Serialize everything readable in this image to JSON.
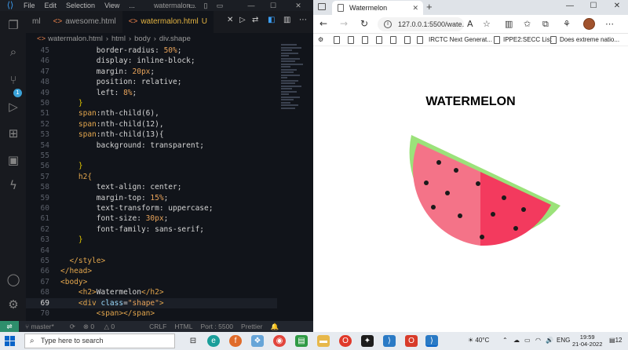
{
  "vscode": {
    "menu": [
      "File",
      "Edit",
      "Selection",
      "View",
      "..."
    ],
    "window_title": "watermalon...",
    "tabs": [
      {
        "label": "ml"
      },
      {
        "label": "awesome.html"
      },
      {
        "label": "watermalon.html",
        "modified": "U"
      }
    ],
    "breadcrumb": [
      "watermalon.html",
      "html",
      "body",
      "div.shape"
    ],
    "code_lines": [
      {
        "n": "45",
        "segs": [
          [
            "        border-radius: ",
            "#d4d4d4"
          ],
          [
            "50%",
            "#e8a35a"
          ],
          [
            ";",
            "#d4d4d4"
          ]
        ]
      },
      {
        "n": "46",
        "segs": [
          [
            "        display: inline-block;",
            "#d4d4d4"
          ]
        ]
      },
      {
        "n": "47",
        "segs": [
          [
            "        margin: ",
            "#d4d4d4"
          ],
          [
            "20px",
            "#e8a35a"
          ],
          [
            ";",
            "#d4d4d4"
          ]
        ]
      },
      {
        "n": "48",
        "segs": [
          [
            "        position: relative;",
            "#d4d4d4"
          ]
        ]
      },
      {
        "n": "49",
        "segs": [
          [
            "        left: ",
            "#d4d4d4"
          ],
          [
            "8%",
            "#e8a35a"
          ],
          [
            ";",
            "#d4d4d4"
          ]
        ]
      },
      {
        "n": "50",
        "segs": [
          [
            "    }",
            "#e3c800"
          ]
        ]
      },
      {
        "n": "51",
        "segs": [
          [
            "    span",
            "#e3a64d"
          ],
          [
            ":nth-child(6),",
            "#d4d4d4"
          ]
        ]
      },
      {
        "n": "52",
        "segs": [
          [
            "    span",
            "#e3a64d"
          ],
          [
            ":nth-child(12),",
            "#d4d4d4"
          ]
        ]
      },
      {
        "n": "53",
        "segs": [
          [
            "    span",
            "#e3a64d"
          ],
          [
            ":nth-child(13){",
            "#d4d4d4"
          ]
        ]
      },
      {
        "n": "54",
        "segs": [
          [
            "        background: transparent;",
            "#d4d4d4"
          ]
        ]
      },
      {
        "n": "55",
        "segs": [
          [
            "",
            "#d4d4d4"
          ]
        ]
      },
      {
        "n": "56",
        "segs": [
          [
            "    }",
            "#e3c800"
          ]
        ]
      },
      {
        "n": "57",
        "segs": [
          [
            "    h2{",
            "#e3a64d"
          ]
        ]
      },
      {
        "n": "58",
        "segs": [
          [
            "        text-align: center;",
            "#d4d4d4"
          ]
        ]
      },
      {
        "n": "59",
        "segs": [
          [
            "        margin-top: ",
            "#d4d4d4"
          ],
          [
            "15%",
            "#e8a35a"
          ],
          [
            ";",
            "#d4d4d4"
          ]
        ]
      },
      {
        "n": "60",
        "segs": [
          [
            "        text-transform: uppercase;",
            "#d4d4d4"
          ]
        ]
      },
      {
        "n": "61",
        "segs": [
          [
            "        font-size: ",
            "#d4d4d4"
          ],
          [
            "30px",
            "#e8a35a"
          ],
          [
            ";",
            "#d4d4d4"
          ]
        ]
      },
      {
        "n": "62",
        "segs": [
          [
            "        font-family: sans-serif;",
            "#d4d4d4"
          ]
        ]
      },
      {
        "n": "63",
        "segs": [
          [
            "    }",
            "#e3c800"
          ]
        ]
      },
      {
        "n": "64",
        "segs": [
          [
            "",
            "#d4d4d4"
          ]
        ]
      },
      {
        "n": "65",
        "segs": [
          [
            "  </style>",
            "#e3a64d"
          ]
        ]
      },
      {
        "n": "66",
        "segs": [
          [
            "</head>",
            "#e3a64d"
          ]
        ]
      },
      {
        "n": "67",
        "segs": [
          [
            "<body>",
            "#e3a64d"
          ]
        ]
      },
      {
        "n": "68",
        "segs": [
          [
            "    <h2>",
            "#e3a64d"
          ],
          [
            "Watermelon",
            "#d4d4d4"
          ],
          [
            "</h2>",
            "#e3a64d"
          ]
        ]
      },
      {
        "n": "69",
        "current": true,
        "segs": [
          [
            "    <div ",
            "#e3a64d"
          ],
          [
            "class",
            "#9cdcfe"
          ],
          [
            "=",
            "#d4d4d4"
          ],
          [
            "\"shape\"",
            "#e8a35a"
          ],
          [
            ">",
            "#e3a64d"
          ]
        ]
      },
      {
        "n": "70",
        "segs": [
          [
            "        <span></span>",
            "#e3a64d"
          ]
        ]
      }
    ],
    "status": {
      "branch": "master*",
      "errors": "0",
      "warnings": "0",
      "eol": "CRLF",
      "lang": "HTML",
      "port": "Port : 5500",
      "prettier": "Prettier"
    },
    "scm_badge": "1"
  },
  "browser": {
    "tab_title": "Watermelon",
    "url": "127.0.0.1:5500/wate...",
    "bookmarks": [
      "IRCTC Next Generat...",
      "IPPE2:SECC List",
      "Does extreme natio..."
    ],
    "page": {
      "heading": "Watermelon"
    }
  },
  "taskbar": {
    "search_placeholder": "Type here to search",
    "weather": "40°C",
    "lang": "ENG",
    "time": "19:59",
    "date": "21-04-2022",
    "notifications": "12"
  },
  "colors": {
    "vscode_accent": "#3c9ff5",
    "rind": "#9be27a",
    "flesh_light": "#f47388",
    "flesh_dark": "#f33a5e",
    "seed": "#1a1a1a"
  }
}
